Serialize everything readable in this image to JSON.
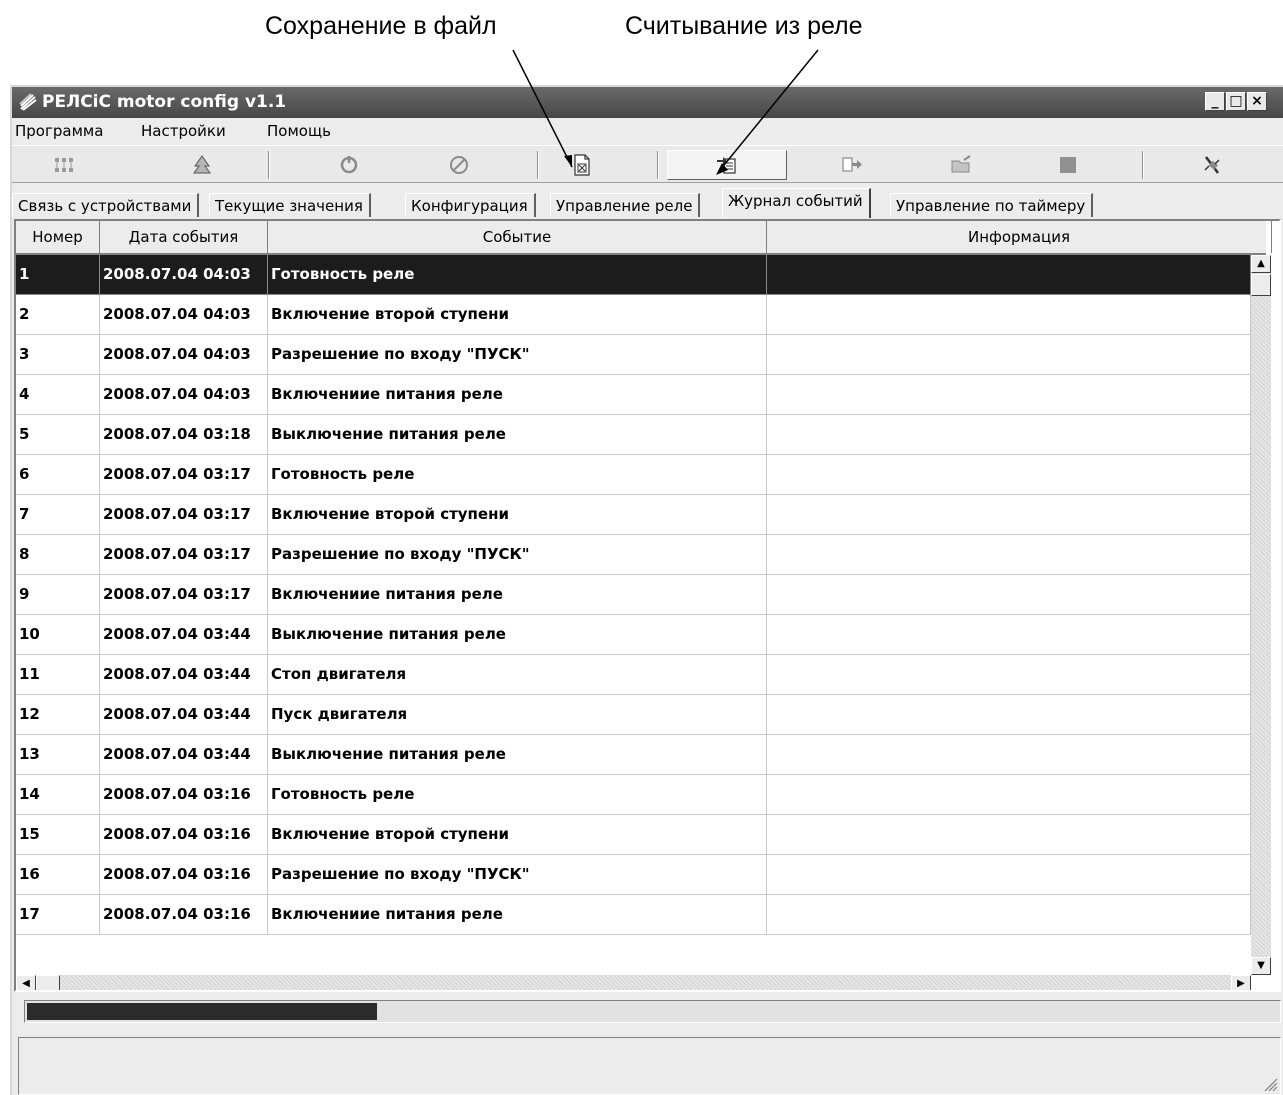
{
  "annotations": {
    "save_to_file": "Сохранение в файл",
    "read_from_relay": "Считывание из реле"
  },
  "window": {
    "title": "РЕЛСіС motor config v1.1",
    "controls": [
      "_",
      "□",
      "×"
    ]
  },
  "menu": {
    "items": [
      "Программа",
      "Настройки",
      "Помощь"
    ]
  },
  "toolbar": {
    "buttons": [
      {
        "icon": "network-icon",
        "pressed": false
      },
      {
        "icon": "tree-icon",
        "pressed": false
      },
      {
        "icon": "refresh-icon",
        "pressed": false
      },
      {
        "icon": "cancel-icon",
        "pressed": false
      },
      {
        "icon": "save-to-file-icon",
        "pressed": false
      },
      {
        "icon": "read-from-relay-icon",
        "pressed": true
      },
      {
        "icon": "write-to-relay-icon",
        "pressed": false
      },
      {
        "icon": "open-folder-icon",
        "pressed": false
      },
      {
        "icon": "stop-icon",
        "pressed": false
      },
      {
        "icon": "disconnect-icon",
        "pressed": false
      }
    ]
  },
  "tabs": [
    {
      "label": "Связь с устройствами",
      "active": false
    },
    {
      "label": "Текущие значения",
      "active": false
    },
    {
      "label": "Конфигурация",
      "active": false
    },
    {
      "label": "Управление реле",
      "active": false
    },
    {
      "label": "Журнал событий",
      "active": true
    },
    {
      "label": "Управление по таймеру",
      "active": false
    }
  ],
  "table": {
    "columns": [
      "Номер",
      "Дата события",
      "Событие",
      "Информация"
    ],
    "rows": [
      {
        "num": "1",
        "date": "2008.07.04 04:03",
        "event": "Готовность реле",
        "info": "",
        "selected": true
      },
      {
        "num": "2",
        "date": "2008.07.04 04:03",
        "event": "Включение второй ступени",
        "info": ""
      },
      {
        "num": "3",
        "date": "2008.07.04 04:03",
        "event": "Разрешение по входу \"ПУСК\"",
        "info": ""
      },
      {
        "num": "4",
        "date": "2008.07.04 04:03",
        "event": "Включениие питания реле",
        "info": ""
      },
      {
        "num": "5",
        "date": "2008.07.04 03:18",
        "event": "Выключение питания реле",
        "info": ""
      },
      {
        "num": "6",
        "date": "2008.07.04 03:17",
        "event": "Готовность реле",
        "info": ""
      },
      {
        "num": "7",
        "date": "2008.07.04 03:17",
        "event": "Включение второй ступени",
        "info": ""
      },
      {
        "num": "8",
        "date": "2008.07.04 03:17",
        "event": "Разрешение по входу \"ПУСК\"",
        "info": ""
      },
      {
        "num": "9",
        "date": "2008.07.04 03:17",
        "event": "Включениие питания реле",
        "info": ""
      },
      {
        "num": "10",
        "date": "2008.07.04 03:44",
        "event": "Выключение питания реле",
        "info": ""
      },
      {
        "num": "11",
        "date": "2008.07.04 03:44",
        "event": "Стоп двигателя",
        "info": ""
      },
      {
        "num": "12",
        "date": "2008.07.04 03:44",
        "event": "Пуск двигателя",
        "info": ""
      },
      {
        "num": "13",
        "date": "2008.07.04 03:44",
        "event": "Выключение питания реле",
        "info": ""
      },
      {
        "num": "14",
        "date": "2008.07.04 03:16",
        "event": "Готовность реле",
        "info": ""
      },
      {
        "num": "15",
        "date": "2008.07.04 03:16",
        "event": "Включение второй ступени",
        "info": ""
      },
      {
        "num": "16",
        "date": "2008.07.04 03:16",
        "event": "Разрешение по входу \"ПУСК\"",
        "info": ""
      },
      {
        "num": "17",
        "date": "2008.07.04 03:16",
        "event": "Включениие питания реле",
        "info": ""
      }
    ]
  },
  "progress": {
    "fraction": 0.28
  },
  "colors": {
    "selected_row_bg": "#1c1c1c",
    "titlebar": "#474747"
  }
}
